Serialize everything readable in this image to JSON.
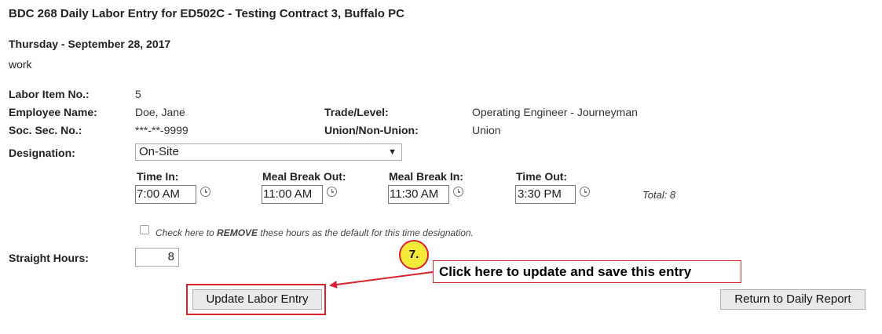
{
  "page": {
    "title": "BDC 268 Daily Labor Entry for ED502C - Testing Contract 3,  Buffalo PC",
    "date": "Thursday - September 28, 2017",
    "work_type": "work"
  },
  "details": {
    "labor_item_label": "Labor Item No.:",
    "labor_item_value": "5",
    "employee_label": "Employee Name:",
    "employee_value": "Doe, Jane",
    "ssn_label": "Soc. Sec. No.:",
    "ssn_value": "***-**-9999",
    "trade_label": "Trade/Level:",
    "trade_value": "Operating Engineer - Journeyman",
    "union_label": "Union/Non-Union:",
    "union_value": "Union"
  },
  "designation": {
    "label": "Designation:",
    "selected": "On-Site"
  },
  "times": {
    "time_in_label": "Time In:",
    "time_in_value": "7:00 AM",
    "meal_out_label": "Meal Break Out:",
    "meal_out_value": "11:00 AM",
    "meal_in_label": "Meal Break In:",
    "meal_in_value": "11:30 AM",
    "time_out_label": "Time Out:",
    "time_out_value": "3:30 PM",
    "total_text": "Total: 8"
  },
  "remove_default": {
    "prefix": "Check here to ",
    "emphasis": "REMOVE",
    "suffix": " these hours as the default for this time designation."
  },
  "straight_hours": {
    "label": "Straight Hours:",
    "value": "8"
  },
  "buttons": {
    "update": "Update Labor Entry",
    "return": "Return to Daily Report"
  },
  "annotation": {
    "step": "7.",
    "callout": "Click here to update and save this entry",
    "color": "#d9232e",
    "badge_color": "#f5ea3a"
  }
}
